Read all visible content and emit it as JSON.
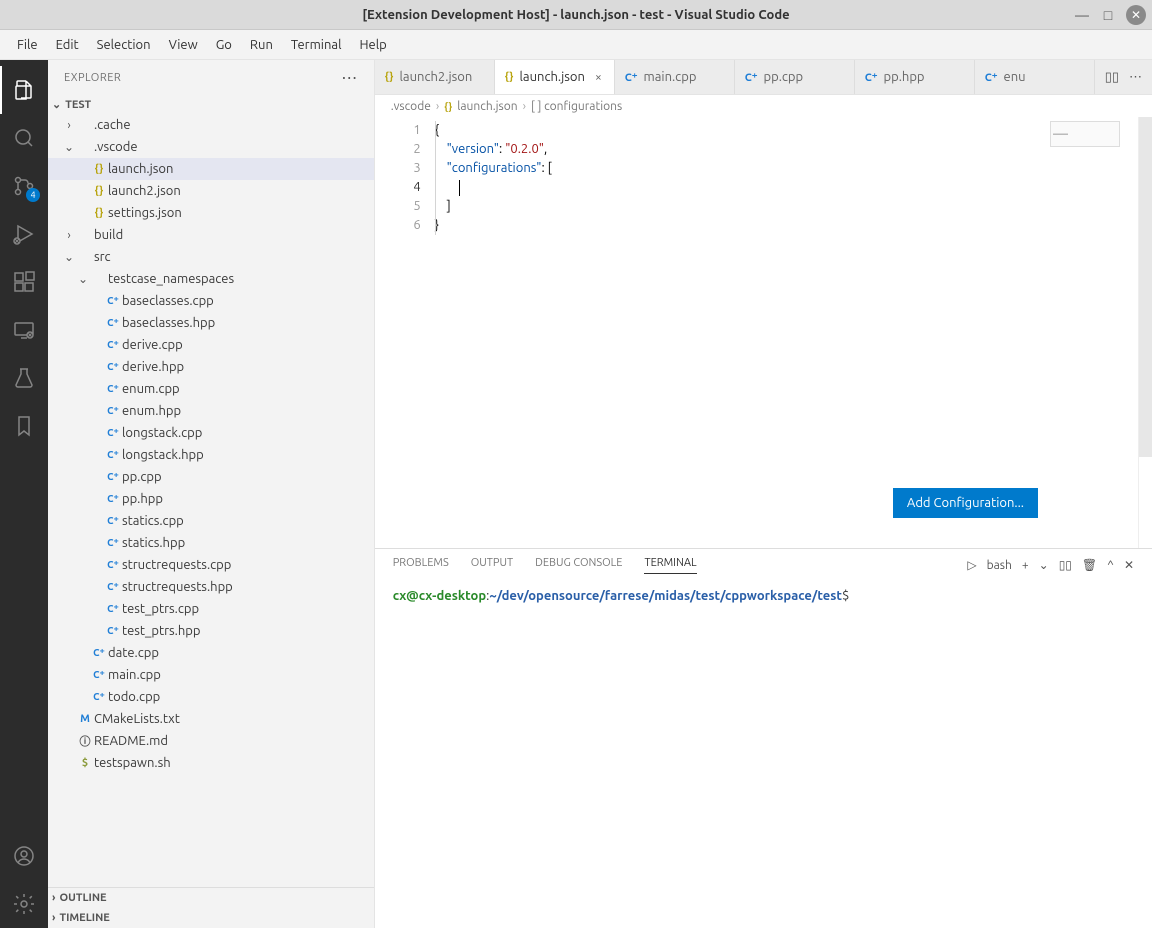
{
  "titlebar": {
    "title": "[Extension Development Host] - launch.json - test - Visual Studio Code"
  },
  "menubar": [
    "File",
    "Edit",
    "Selection",
    "View",
    "Go",
    "Run",
    "Terminal",
    "Help"
  ],
  "activitybar": {
    "scm_badge": "4"
  },
  "sidebar": {
    "title": "EXPLORER",
    "root": "TEST",
    "outline": "OUTLINE",
    "timeline": "TIMELINE",
    "tree": [
      {
        "indent": 14,
        "tw": "›",
        "ico": "",
        "cls": "",
        "label": ".cache"
      },
      {
        "indent": 14,
        "tw": "⌄",
        "ico": "",
        "cls": "",
        "label": ".vscode"
      },
      {
        "indent": 28,
        "tw": "",
        "ico": "{}",
        "cls": "json",
        "label": "launch.json",
        "selected": true
      },
      {
        "indent": 28,
        "tw": "",
        "ico": "{}",
        "cls": "json",
        "label": "launch2.json"
      },
      {
        "indent": 28,
        "tw": "",
        "ico": "{}",
        "cls": "json",
        "label": "settings.json"
      },
      {
        "indent": 14,
        "tw": "›",
        "ico": "",
        "cls": "",
        "label": "build"
      },
      {
        "indent": 14,
        "tw": "⌄",
        "ico": "",
        "cls": "",
        "label": "src"
      },
      {
        "indent": 28,
        "tw": "⌄",
        "ico": "",
        "cls": "",
        "label": "testcase_namespaces"
      },
      {
        "indent": 42,
        "tw": "",
        "ico": "C⁺",
        "cls": "cpp",
        "label": "baseclasses.cpp"
      },
      {
        "indent": 42,
        "tw": "",
        "ico": "C⁺",
        "cls": "cpp",
        "label": "baseclasses.hpp"
      },
      {
        "indent": 42,
        "tw": "",
        "ico": "C⁺",
        "cls": "cpp",
        "label": "derive.cpp"
      },
      {
        "indent": 42,
        "tw": "",
        "ico": "C⁺",
        "cls": "cpp",
        "label": "derive.hpp"
      },
      {
        "indent": 42,
        "tw": "",
        "ico": "C⁺",
        "cls": "cpp",
        "label": "enum.cpp"
      },
      {
        "indent": 42,
        "tw": "",
        "ico": "C⁺",
        "cls": "cpp",
        "label": "enum.hpp"
      },
      {
        "indent": 42,
        "tw": "",
        "ico": "C⁺",
        "cls": "cpp",
        "label": "longstack.cpp"
      },
      {
        "indent": 42,
        "tw": "",
        "ico": "C⁺",
        "cls": "cpp",
        "label": "longstack.hpp"
      },
      {
        "indent": 42,
        "tw": "",
        "ico": "C⁺",
        "cls": "cpp",
        "label": "pp.cpp"
      },
      {
        "indent": 42,
        "tw": "",
        "ico": "C⁺",
        "cls": "cpp",
        "label": "pp.hpp"
      },
      {
        "indent": 42,
        "tw": "",
        "ico": "C⁺",
        "cls": "cpp",
        "label": "statics.cpp"
      },
      {
        "indent": 42,
        "tw": "",
        "ico": "C⁺",
        "cls": "cpp",
        "label": "statics.hpp"
      },
      {
        "indent": 42,
        "tw": "",
        "ico": "C⁺",
        "cls": "cpp",
        "label": "structrequests.cpp"
      },
      {
        "indent": 42,
        "tw": "",
        "ico": "C⁺",
        "cls": "cpp",
        "label": "structrequests.hpp"
      },
      {
        "indent": 42,
        "tw": "",
        "ico": "C⁺",
        "cls": "cpp",
        "label": "test_ptrs.cpp"
      },
      {
        "indent": 42,
        "tw": "",
        "ico": "C⁺",
        "cls": "cpp",
        "label": "test_ptrs.hpp"
      },
      {
        "indent": 28,
        "tw": "",
        "ico": "C⁺",
        "cls": "cpp",
        "label": "date.cpp"
      },
      {
        "indent": 28,
        "tw": "",
        "ico": "C⁺",
        "cls": "cpp",
        "label": "main.cpp"
      },
      {
        "indent": 28,
        "tw": "",
        "ico": "C⁺",
        "cls": "cpp",
        "label": "todo.cpp"
      },
      {
        "indent": 14,
        "tw": "",
        "ico": "M",
        "cls": "cmake",
        "label": "CMakeLists.txt"
      },
      {
        "indent": 14,
        "tw": "",
        "ico": "ⓘ",
        "cls": "md",
        "label": "README.md"
      },
      {
        "indent": 14,
        "tw": "",
        "ico": "$",
        "cls": "sh",
        "label": "testspawn.sh"
      }
    ]
  },
  "tabs": [
    {
      "ico": "{}",
      "cls": "json",
      "label": "launch2.json",
      "active": false,
      "close": ""
    },
    {
      "ico": "{}",
      "cls": "json",
      "label": "launch.json",
      "active": true,
      "close": "×"
    },
    {
      "ico": "C⁺",
      "cls": "cpp",
      "label": "main.cpp",
      "active": false,
      "close": ""
    },
    {
      "ico": "C⁺",
      "cls": "cpp",
      "label": "pp.cpp",
      "active": false,
      "close": ""
    },
    {
      "ico": "C⁺",
      "cls": "cpp",
      "label": "pp.hpp",
      "active": false,
      "close": ""
    },
    {
      "ico": "C⁺",
      "cls": "cpp",
      "label": "enu",
      "active": false,
      "close": ""
    }
  ],
  "breadcrumb": {
    "folder": ".vscode",
    "file": "launch.json",
    "symbol": "[ ] configurations"
  },
  "editor": {
    "line1": "{",
    "line2_key": "\"version\"",
    "line2_val": "\"0.2.0\"",
    "line3_key": "\"configurations\"",
    "line4": "",
    "line5": "]",
    "line6": "}",
    "add_config_btn": "Add Configuration..."
  },
  "panel": {
    "tabs": [
      "PROBLEMS",
      "OUTPUT",
      "DEBUG CONSOLE",
      "TERMINAL"
    ],
    "active_tab": "TERMINAL",
    "shell_label": "bash",
    "term_user": "cx@cx-desktop",
    "term_path": "~/dev/opensource/farrese/midas/test/cppworkspace/test",
    "term_prompt": "$"
  }
}
